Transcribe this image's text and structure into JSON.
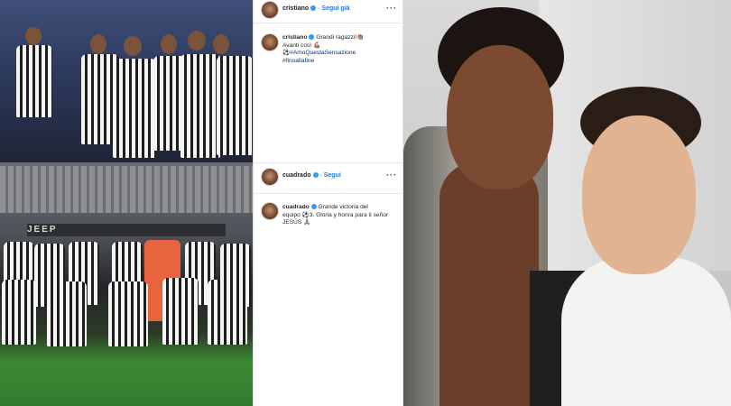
{
  "photos": {
    "team_top": {
      "icon": "team-celebration-photo"
    },
    "team_bottom": {
      "icon": "team-lineup-photo",
      "banner_text": "JEEP"
    },
    "selfie": {
      "icon": "players-selfie-photo"
    }
  },
  "posts": [
    {
      "header_user": "cristiano",
      "header_follow": "Segui già",
      "more_icon": "more-dots-icon",
      "comment_user": "cristiano",
      "comment_lines": [
        "Grandi ragazzi!👏🏽",
        "Avanti così 💪🏽"
      ],
      "hashtag_line_1": "⚽#AmoQuestaSensazione",
      "hashtag_line_2": "#finoallafine"
    },
    {
      "header_user": "cuadrado",
      "header_follow": "Segui",
      "more_icon": "more-dots-icon",
      "comment_user": "cuadrado",
      "comment_lines": [
        "Grande victoria del",
        "equipo ⚽3. Gloria y honra para ti señor",
        "JESÚS 🙏🏽"
      ]
    }
  ],
  "colors": {
    "follow_blue": "#2a7ad5",
    "verified_blue": "#3897f0",
    "hashtag": "#00376b"
  }
}
